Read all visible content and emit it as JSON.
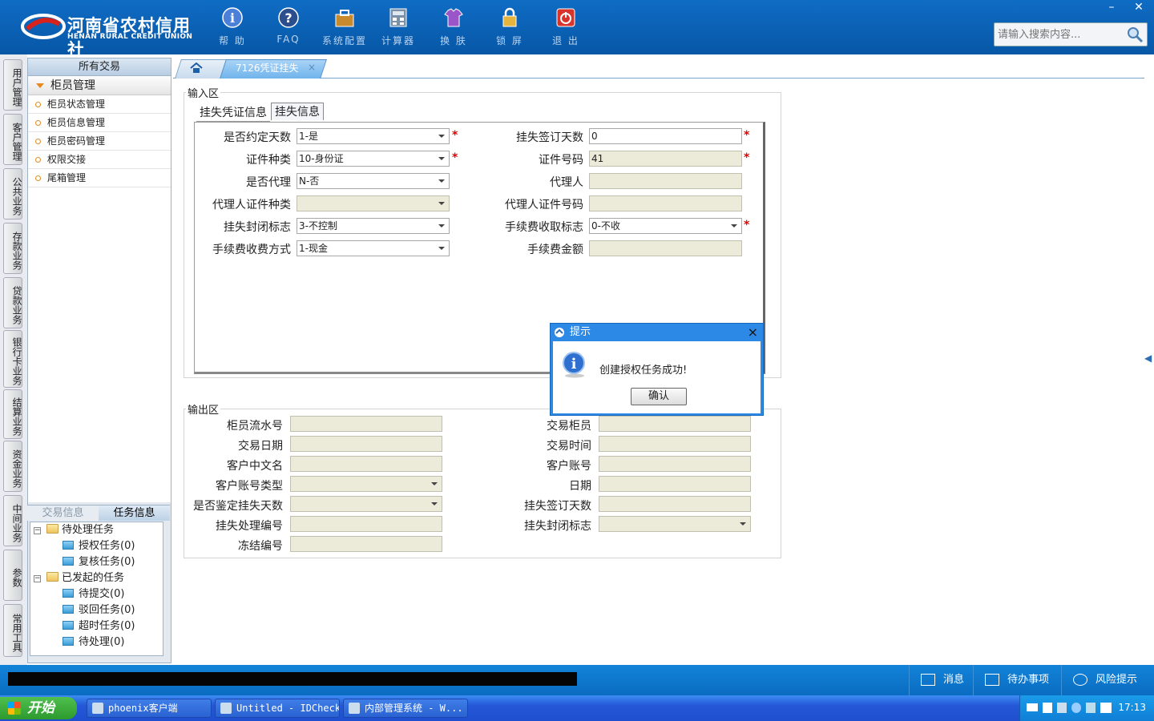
{
  "header": {
    "logo_cn": "河南省农村信用社",
    "logo_en": "HENAN RURAL CREDIT UNION",
    "toolbar": [
      {
        "label": "帮 助",
        "icon": "info-icon"
      },
      {
        "label": "FAQ",
        "icon": "question-icon"
      },
      {
        "label": "系统配置",
        "icon": "toolbox-icon"
      },
      {
        "label": "计算器",
        "icon": "calculator-icon"
      },
      {
        "label": "换 肤",
        "icon": "shirt-icon"
      },
      {
        "label": "锁 屏",
        "icon": "lock-icon"
      },
      {
        "label": "退 出",
        "icon": "power-icon"
      }
    ],
    "search_placeholder": "请输入搜索内容..."
  },
  "left_tabs": [
    "用户管理",
    "客户管理",
    "公共业务",
    "存款业务",
    "贷款业务",
    "银行卡业务",
    "结算业务",
    "资金业务",
    "中间业务",
    "参数",
    "常用工具"
  ],
  "sidebar": {
    "header": "所有交易",
    "group": "柜员管理",
    "items": [
      "柜员状态管理",
      "柜员信息管理",
      "柜员密码管理",
      "权限交接",
      "尾箱管理"
    ],
    "bottom_tabs": [
      "交易信息",
      "任务信息"
    ],
    "tree": {
      "pending": "待处理任务",
      "pending_children": [
        "授权任务(0)",
        "复核任务(0)"
      ],
      "initiated": "已发起的任务",
      "initiated_children": [
        "待提交(0)",
        "驳回任务(0)",
        "超时任务(0)",
        "待处理(0)"
      ]
    }
  },
  "tabs": {
    "active": "7126凭证挂失",
    "close": "×"
  },
  "input_area": {
    "legend": "输入区",
    "inner_tabs": [
      "挂失凭证信息",
      "挂失信息"
    ],
    "left_fields": [
      {
        "label": "是否约定天数",
        "value": "1-是",
        "type": "select",
        "required": true
      },
      {
        "label": "证件种类",
        "value": "10-身份证",
        "type": "select",
        "required": true
      },
      {
        "label": "是否代理",
        "value": "N-否",
        "type": "select",
        "required": false
      },
      {
        "label": "代理人证件种类",
        "value": "",
        "type": "select-disabled",
        "required": false
      },
      {
        "label": "挂失封闭标志",
        "value": "3-不控制",
        "type": "select",
        "required": false
      },
      {
        "label": "手续费收费方式",
        "value": "1-现金",
        "type": "select",
        "required": false
      }
    ],
    "right_fields": [
      {
        "label": "挂失签订天数",
        "value": "0",
        "type": "input",
        "required": true
      },
      {
        "label": "证件号码",
        "value": "41",
        "type": "input-disabled",
        "required": true
      },
      {
        "label": "代理人",
        "value": "",
        "type": "input-disabled",
        "required": false
      },
      {
        "label": "代理人证件号码",
        "value": "",
        "type": "input-disabled",
        "required": false
      },
      {
        "label": "手续费收取标志",
        "value": "0-不收",
        "type": "select",
        "required": true
      },
      {
        "label": "手续费金额",
        "value": "",
        "type": "input-disabled",
        "required": false
      }
    ],
    "required_mark": "*"
  },
  "output_area": {
    "legend": "输出区",
    "left_fields": [
      "柜员流水号",
      "交易日期",
      "客户中文名",
      "客户账号类型",
      "是否鉴定挂失天数",
      "挂失处理编号",
      "冻结编号"
    ],
    "right_fields": [
      "交易柜员",
      "交易时间",
      "客户账号",
      "日期",
      "挂失签订天数",
      "挂失封闭标志"
    ]
  },
  "dialog": {
    "title": "提示",
    "message": "创建授权任务成功!",
    "ok_label": "确认",
    "close": "×"
  },
  "statusbar": {
    "buttons": [
      "消息",
      "待办事项",
      "风险提示"
    ]
  },
  "taskbar": {
    "start_label": "开始",
    "tasks": [
      "phoenix客户端",
      "Untitled - IDCheck",
      "内部管理系统 - W..."
    ],
    "clock": "17:13"
  },
  "colors": {
    "header_blue": "#0b64b8",
    "accent_orange": "#e58a1f",
    "required_red": "#dd0000",
    "dialog_blue": "#2c8ae6"
  }
}
